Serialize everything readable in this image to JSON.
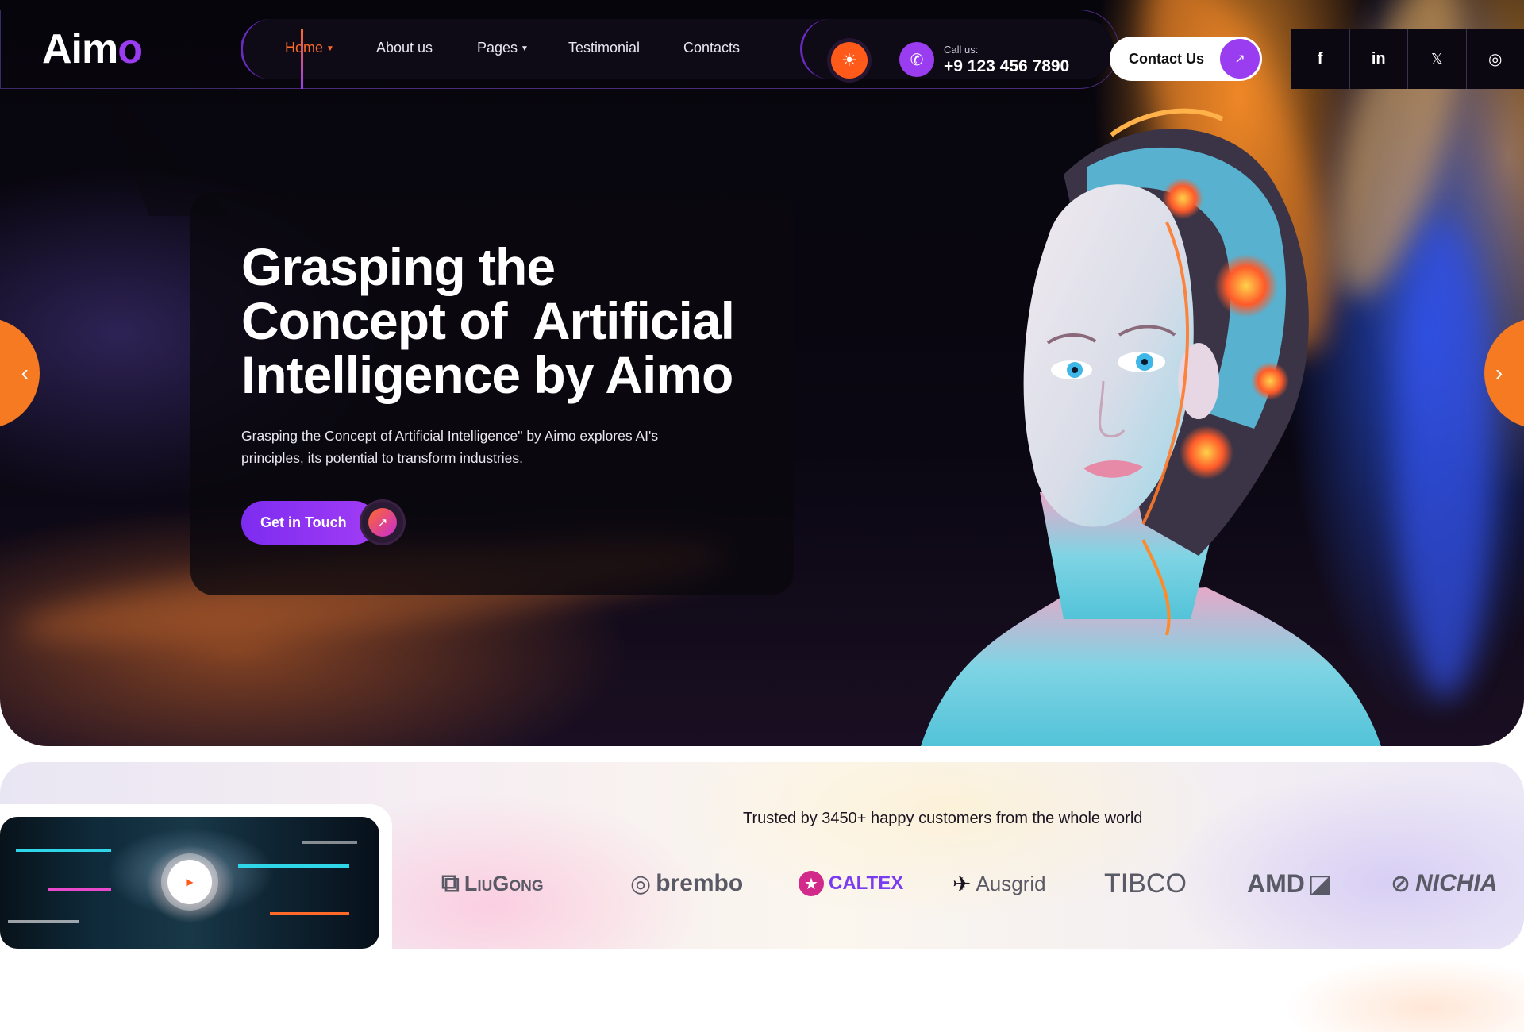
{
  "brand": {
    "logo_main": "Aim",
    "logo_accent": "o"
  },
  "nav": {
    "items": [
      {
        "label": "Home",
        "has_dropdown": true,
        "active": true
      },
      {
        "label": "About us",
        "has_dropdown": false
      },
      {
        "label": "Pages",
        "has_dropdown": true
      },
      {
        "label": "Testimonial",
        "has_dropdown": false
      },
      {
        "label": "Contacts",
        "has_dropdown": false
      }
    ]
  },
  "header": {
    "call_label": "Call us:",
    "phone": "+9 123 456 7890",
    "contact_button": "Contact Us",
    "theme_toggle_icon": "sun-icon",
    "social": [
      {
        "icon": "facebook-icon",
        "glyph": "f"
      },
      {
        "icon": "linkedin-icon",
        "glyph": "in"
      },
      {
        "icon": "x-twitter-icon",
        "glyph": "𝕏"
      },
      {
        "icon": "instagram-icon",
        "glyph": "◎"
      }
    ]
  },
  "hero": {
    "title_lines": [
      "Grasping the",
      "Concept of  Artificial",
      "Intelligence by Aimo"
    ],
    "description": "Grasping the Concept of Artificial Intelligence\" by Aimo explores AI's principles, its potential to transform industries.",
    "cta_label": "Get in Touch",
    "prev_icon": "chevron-left-icon",
    "next_icon": "chevron-right-icon"
  },
  "trusted": {
    "text": "Trusted by 3450+ happy customers from the whole world",
    "brands": [
      "LiuGong",
      "brembo",
      "CALTEX",
      "Ausgrid",
      "TIBCO",
      "AMD",
      "NICHIA"
    ]
  },
  "colors": {
    "accent_orange": "#ff6a2a",
    "accent_purple": "#9a3cf0",
    "dark_bg": "#0e0a16"
  }
}
